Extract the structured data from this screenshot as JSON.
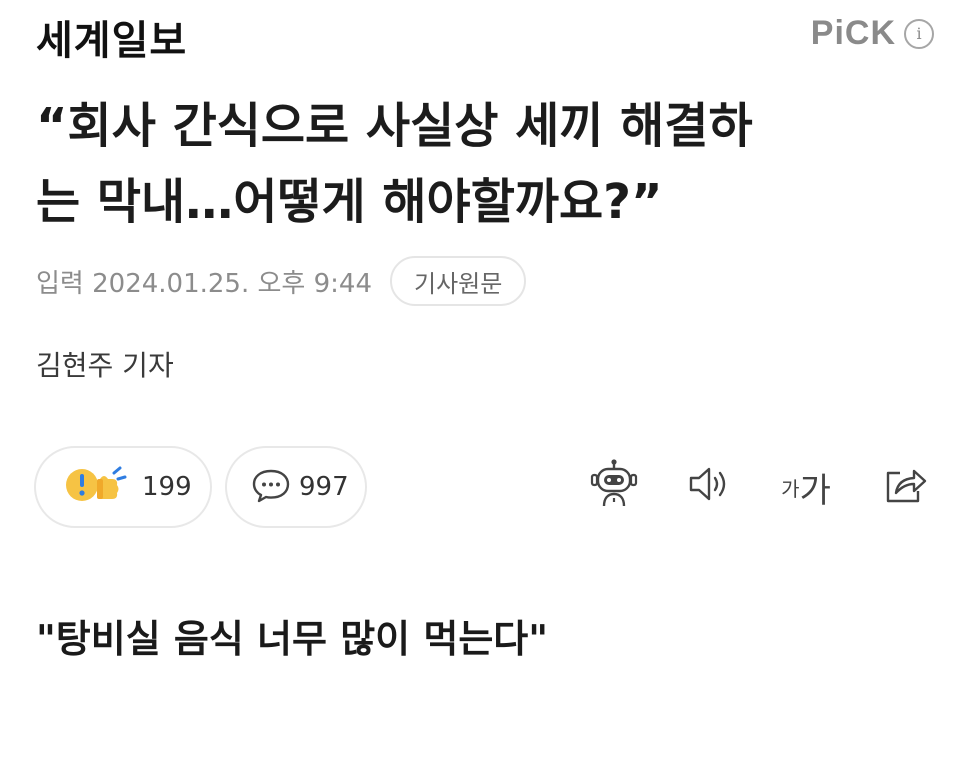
{
  "header": {
    "press_name": "세계일보",
    "pick_label": "PiCK",
    "info_icon_glyph": "i"
  },
  "article": {
    "headline_line1": "“회사 간식으로 사실상 세끼 해결하",
    "headline_line2": "는 막내…어떻게 해야할까요?”",
    "published": "입력 2024.01.25. 오후 9:44",
    "original_button": "기사원문",
    "reporter": "김현주 기자",
    "subheadline": "\"탕비실 음식 너무 많이 먹는다\""
  },
  "actions": {
    "reaction_count": "199",
    "comment_count": "997",
    "font_size_small": "가",
    "font_size_large": "가"
  },
  "icons": {
    "reaction": "reaction-emoji-icon",
    "comment": "comment-bubble-icon",
    "summary_bot": "robot-summary-icon",
    "tts": "speaker-icon",
    "font": "font-size-icon",
    "share": "share-icon"
  },
  "colors": {
    "text": "#1c1c1c",
    "meta_gray": "#8c8c8c",
    "border": "#e6e6e6",
    "reaction_yellow": "#f6c344",
    "reaction_blue": "#2f7de1"
  }
}
